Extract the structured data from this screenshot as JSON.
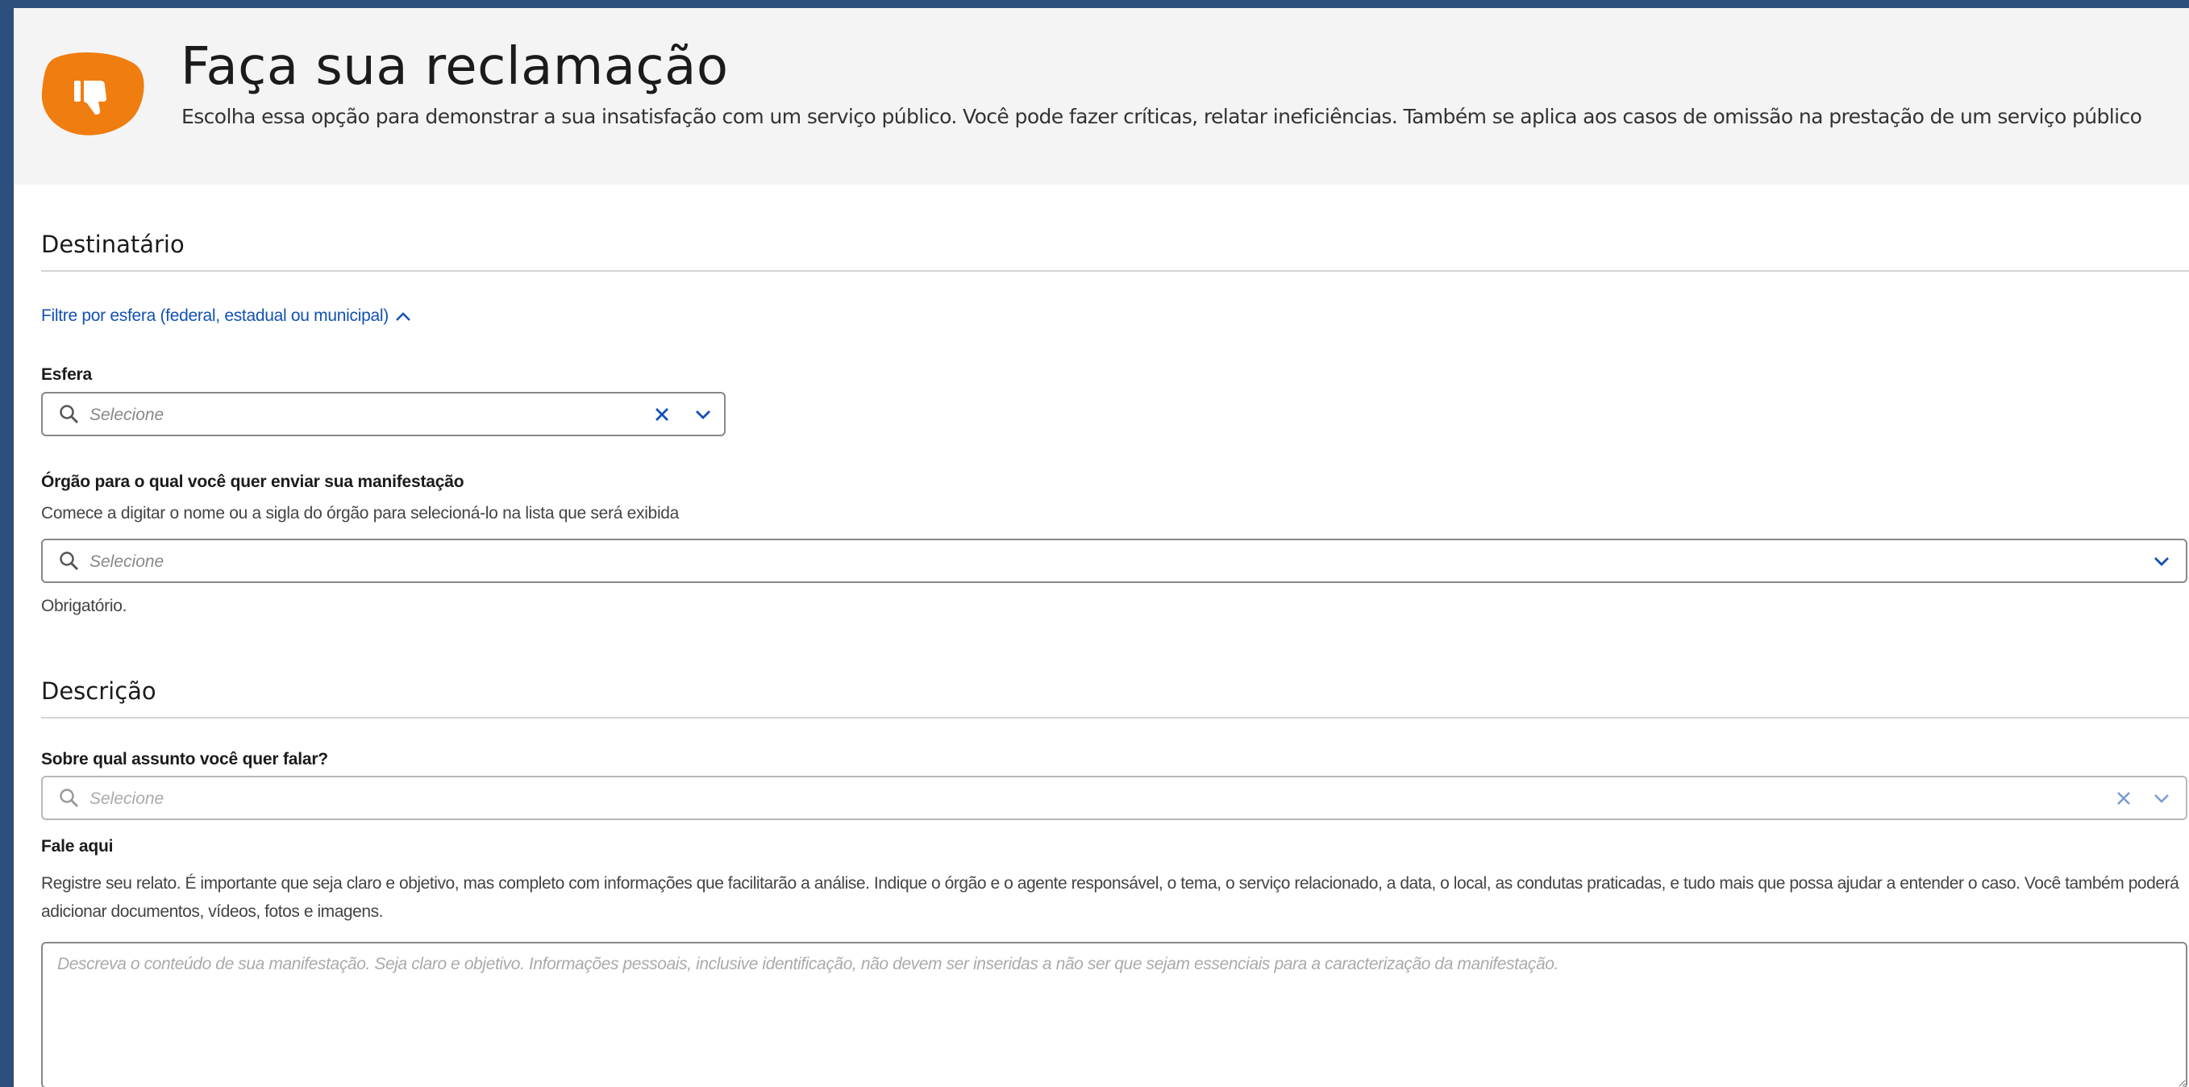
{
  "header": {
    "title": "Faça sua reclamação",
    "description": "Escolha essa opção para demonstrar a sua insatisfação com um serviço público. Você pode fazer críticas, relatar ineficiências. Também se aplica aos casos de omissão na prestação de um serviço público",
    "icon": "thumbs-down-icon",
    "icon_color": "#f07d0f"
  },
  "destinatario": {
    "title": "Destinatário",
    "filter_link": "Filtre por esfera (federal, estadual ou municipal)",
    "esfera": {
      "label": "Esfera",
      "placeholder": "Selecione"
    },
    "orgao": {
      "label": "Órgão para o qual você quer enviar sua manifestação",
      "help": "Comece a digitar o nome ou a sigla do órgão para selecioná-lo na lista que será exibida",
      "placeholder": "Selecione",
      "required_hint": "Obrigatório."
    }
  },
  "descricao": {
    "title": "Descrição",
    "assunto": {
      "label": "Sobre qual assunto você quer falar?",
      "placeholder": "Selecione"
    },
    "fale_aqui": {
      "label": "Fale aqui",
      "help": "Registre seu relato. É importante que seja claro e objetivo, mas completo com informações que facilitarão a análise. Indique o órgão e o agente responsável, o tema, o serviço relacionado, a data, o local, as condutas praticadas, e tudo mais que possa ajudar a entender o caso. Você também poderá adicionar documentos, vídeos, fotos e imagens.",
      "placeholder": "Descreva o conteúdo de sua manifestação. Seja claro e objetivo. Informações pessoais, inclusive identificação, não devem ser inseridas a não ser que sejam essenciais para a caracterização da manifestação."
    }
  },
  "colors": {
    "link": "#1351b4",
    "frame": "#2c4f7c",
    "header_bg": "#f4f4f4"
  }
}
